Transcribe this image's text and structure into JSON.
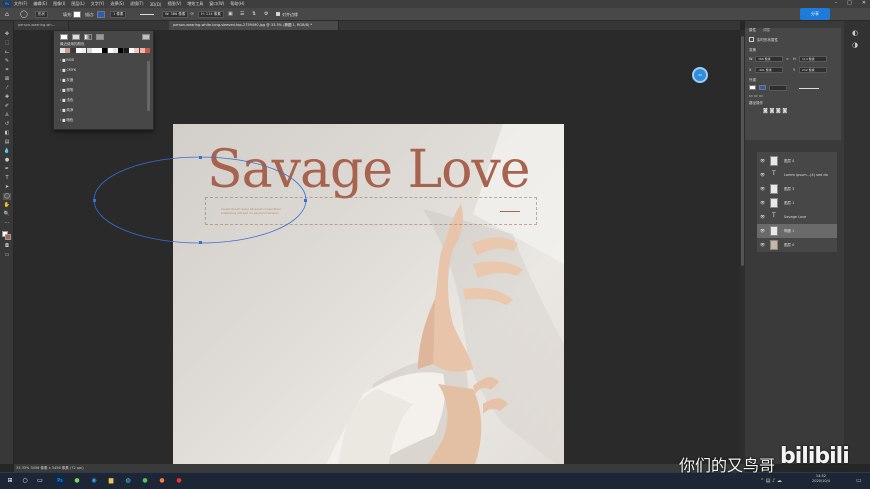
{
  "menubar": {
    "items": [
      "文件(F)",
      "编辑(E)",
      "图像(I)",
      "图层(L)",
      "文字(Y)",
      "选择(S)",
      "滤镜(T)",
      "3D(D)",
      "视图(V)",
      "增效工具",
      "窗口(W)",
      "帮助(H)"
    ]
  },
  "optionsbar": {
    "mode_label": "形状",
    "fill_label": "填充:",
    "stroke_label": "描边:",
    "stroke_width": "1 像素",
    "w_value": "W: 386 像素",
    "h_value": "H: 114 像素",
    "align_label": "对齐边缘",
    "cloud_label": "分享"
  },
  "tabs": [
    {
      "label": "person-wearing-wh..."
    },
    {
      "label": "person-wearing-white-long-sleeved-top-2759490.jpg @ 33.3% (椭圆 1, RGB/8) *"
    }
  ],
  "swatches_panel": {
    "recent_label": "最近使用的颜色",
    "colors": [
      "#e4e4e4",
      "#c8a094",
      "#3a3a3a",
      "#ffffff",
      "#f0f0f0",
      "#d9d9d9",
      "#ffffff",
      "#ffffff",
      "#000000",
      "#ffffff",
      "#e8e8e8",
      "#000000",
      "#1a1a1a",
      "#ffffff",
      "#f6c9c0",
      "#f1b3a8",
      "#c85a4a"
    ],
    "folders": [
      "RGB",
      "CMYK",
      "灰度",
      "蜡笔",
      "浅色",
      "纯净",
      "暗色"
    ]
  },
  "document": {
    "headline": "Savage Love",
    "lorem": "Lorem ipsum dolor sit amet consectetur adipiscing elit sed do eiusmod tempor"
  },
  "properties": {
    "tab_label": "属性",
    "tab2_label": "调整",
    "section_label": "实时形状属性",
    "transform_label": "变换",
    "w": "386 像素",
    "h": "114 像素",
    "x": "-491 像素",
    "y": "232 像素",
    "appearance_label": "外观",
    "pathops_label": "路径操作"
  },
  "layers": [
    {
      "name": "图层 4",
      "type": "image",
      "selected": false
    },
    {
      "name": "Lorem ipsum...(4) sed do",
      "type": "text",
      "selected": false
    },
    {
      "name": "图层 3",
      "type": "image",
      "selected": false
    },
    {
      "name": "图层 1",
      "type": "image",
      "selected": false
    },
    {
      "name": "Savage Love",
      "type": "text",
      "selected": false
    },
    {
      "name": "椭圆 1",
      "type": "shape",
      "selected": true
    },
    {
      "name": "图层 0",
      "type": "photo",
      "selected": false
    }
  ],
  "status": {
    "zoom_doc": "33.33%   3456 像素 x 3456 像素 (72 ppi)"
  },
  "bubble_label": "32",
  "watermark": "你们的又鸟哥",
  "brand": "bilibili",
  "clock": {
    "time": "14:52",
    "date": "2020/10/4"
  }
}
